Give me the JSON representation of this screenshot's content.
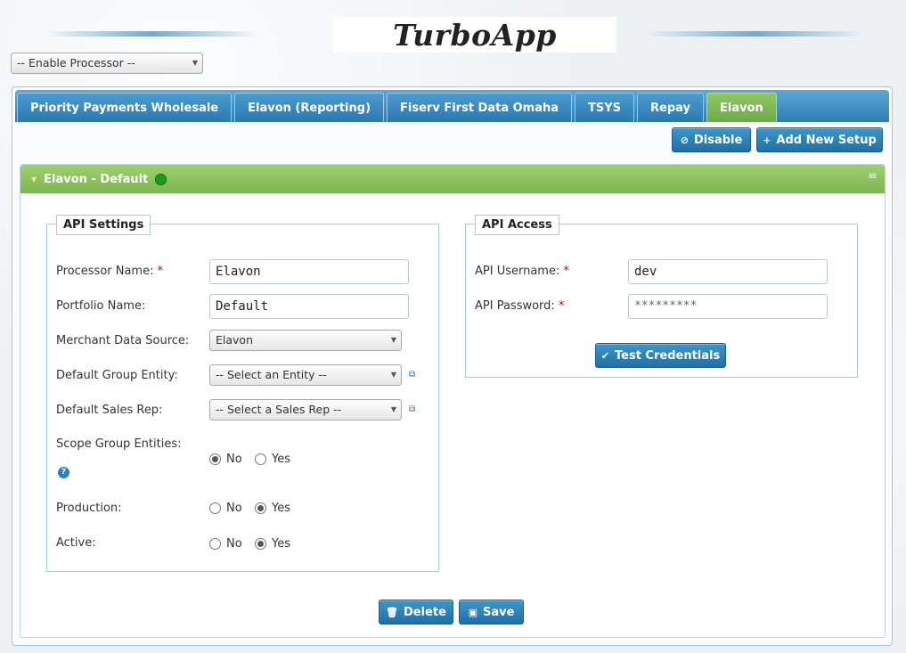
{
  "app": {
    "title": "TurboApp"
  },
  "processor_select": {
    "value": "-- Enable Processor --"
  },
  "tabs": [
    {
      "label": "Priority Payments Wholesale"
    },
    {
      "label": "Elavon (Reporting)"
    },
    {
      "label": "Fiserv First Data Omaha"
    },
    {
      "label": "TSYS"
    },
    {
      "label": "Repay"
    },
    {
      "label": "Elavon",
      "active": true
    }
  ],
  "toolbar": {
    "disable_label": "Disable",
    "add_label": "Add New Setup"
  },
  "panel": {
    "title": "Elavon - Default",
    "status_color": "#1a9c1a"
  },
  "api_settings": {
    "legend": "API Settings",
    "processor_name_label": "Processor Name:",
    "processor_name_value": "Elavon",
    "portfolio_name_label": "Portfolio Name:",
    "portfolio_name_value": "Default",
    "merchant_source_label": "Merchant Data Source:",
    "merchant_source_value": "Elavon",
    "group_entity_label": "Default Group Entity:",
    "group_entity_value": "-- Select an Entity --",
    "sales_rep_label": "Default Sales Rep:",
    "sales_rep_value": "-- Select a Sales Rep --",
    "scope_label": "Scope Group Entities:",
    "production_label": "Production:",
    "active_label": "Active:",
    "no": "No",
    "yes": "Yes",
    "required_mark": "*",
    "help_mark": "?"
  },
  "api_access": {
    "legend": "API Access",
    "username_label": "API Username:",
    "username_value": "dev",
    "password_label": "API Password:",
    "password_value": "*********",
    "test_label": "Test Credentials"
  },
  "footer": {
    "delete_label": "Delete",
    "save_label": "Save"
  },
  "colors": {
    "accent_blue": "#2f7cb3",
    "accent_green": "#7cb54e",
    "required": "#dd0000"
  }
}
